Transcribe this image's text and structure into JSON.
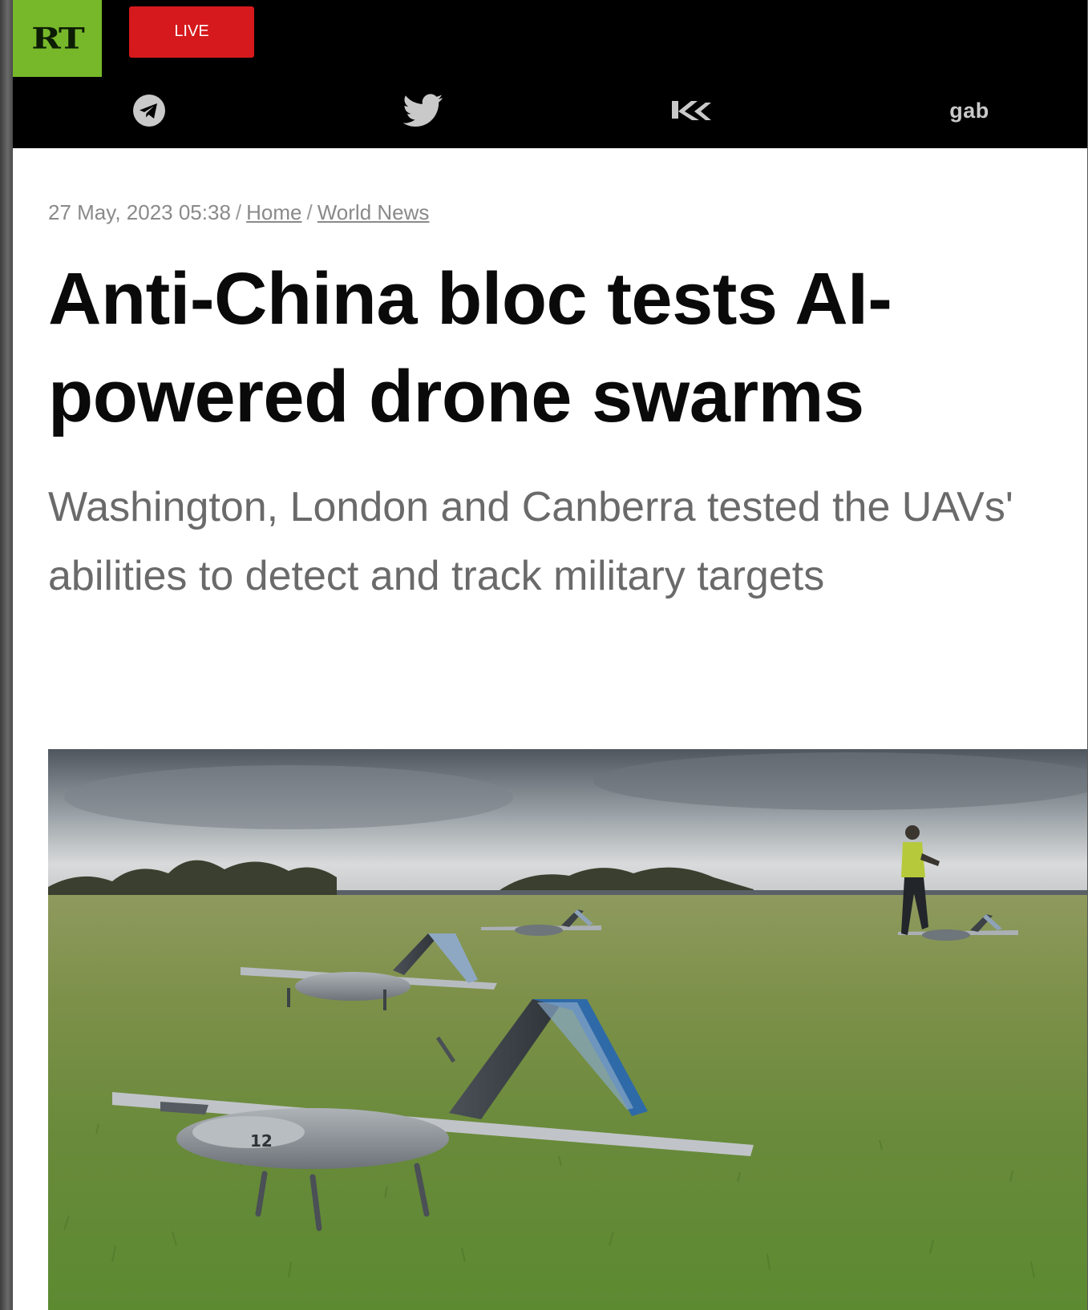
{
  "header": {
    "logo_text": "RT",
    "live_label": "LIVE",
    "social": [
      {
        "name": "telegram-icon"
      },
      {
        "name": "twitter-icon"
      },
      {
        "name": "vk-icon"
      },
      {
        "name": "gab-icon",
        "label": "gab"
      }
    ]
  },
  "article": {
    "date": "27 May, 2023 05:38",
    "breadcrumb": [
      "Home",
      "World News"
    ],
    "title": "Anti-China bloc tests AI-powered drone swarms",
    "summary": "Washington, London and Canberra tested the UAVs' abilities to detect and track military targets",
    "hero_image": {
      "subject": "drones on grass field",
      "drone_number": "12"
    }
  },
  "colors": {
    "logo_green": "#77b82a",
    "live_red": "#d5191c",
    "header_black": "#000000",
    "meta_gray": "#8a8a8a",
    "summary_gray": "#6a6a6a"
  }
}
